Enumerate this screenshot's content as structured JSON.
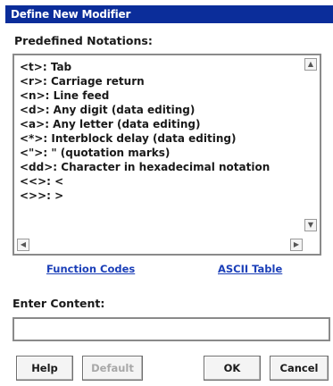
{
  "window": {
    "title": "Define New Modifier"
  },
  "notations": {
    "label": "Predefined Notations:",
    "items": [
      "<t>: Tab",
      "<r>: Carriage return",
      "<n>: Line feed",
      "<d>: Any digit (data editing)",
      "<a>: Any letter (data editing)",
      "<*>: Interblock delay (data editing)",
      "<\">: \" (quotation marks)",
      "<dd>: Character in hexadecimal notation",
      "<<>: <",
      "<>>: >"
    ]
  },
  "links": {
    "function_codes": "Function Codes",
    "ascii_table": "ASCII Table"
  },
  "content": {
    "label": "Enter Content:",
    "value": ""
  },
  "buttons": {
    "help": "Help",
    "default": "Default",
    "ok": "OK",
    "cancel": "Cancel"
  },
  "colors": {
    "titlebar": "#0b2d9a",
    "link": "#1b3fb8"
  }
}
